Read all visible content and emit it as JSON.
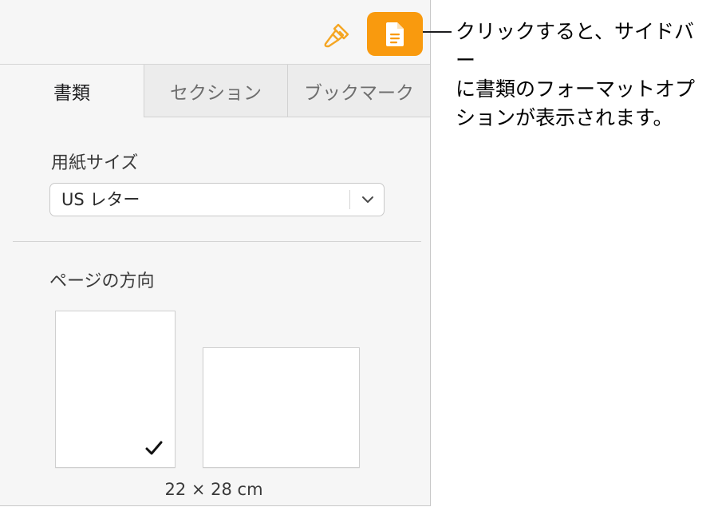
{
  "toolbar": {
    "format_icon": "paintbrush-icon",
    "document_icon": "document-icon",
    "accent_color": "#f99a0e"
  },
  "tabs": [
    {
      "label": "書類",
      "active": true
    },
    {
      "label": "セクション",
      "active": false
    },
    {
      "label": "ブックマーク",
      "active": false
    }
  ],
  "paper_size": {
    "label": "用紙サイズ",
    "value": "US レター",
    "chevron_icon": "chevron-down-icon"
  },
  "orientation": {
    "label": "ページの方向",
    "options": [
      {
        "name": "portrait",
        "selected": true
      },
      {
        "name": "landscape",
        "selected": false
      }
    ],
    "checkmark_icon": "checkmark-icon",
    "size_text": "22 × 28 cm"
  },
  "callout": {
    "text": "クリックすると、サイドバー\nに書類のフォーマットオプ\nションが表示されます。"
  }
}
